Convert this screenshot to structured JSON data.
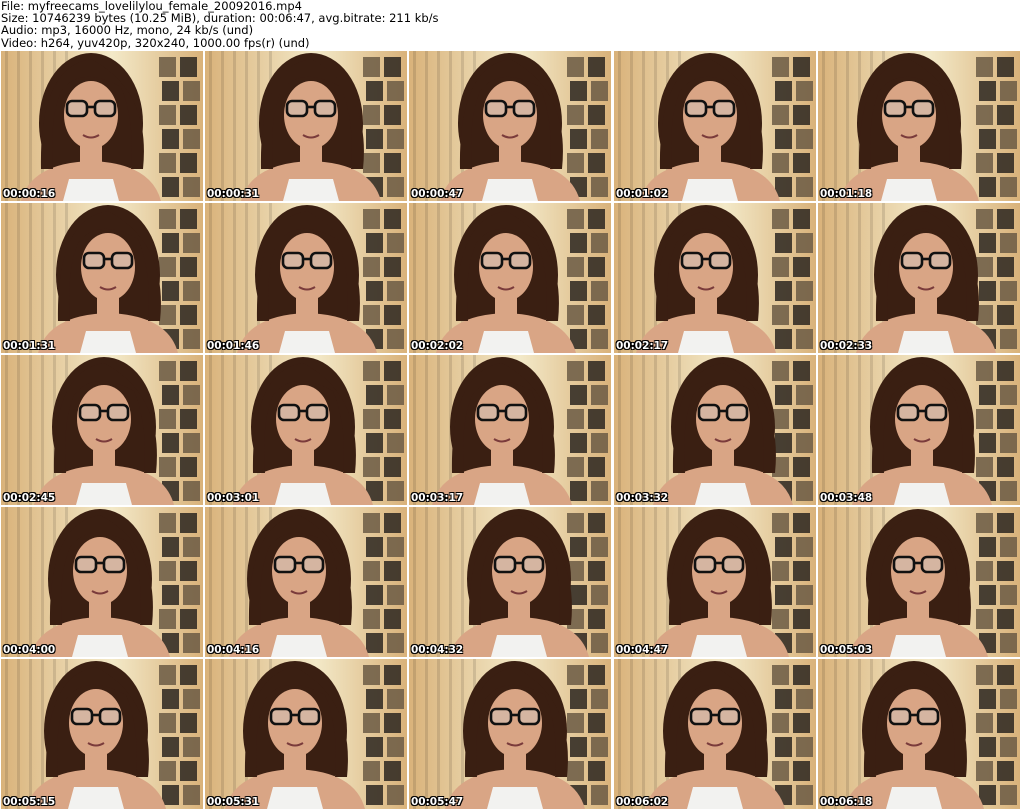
{
  "header": {
    "file": "File: myfreecams_lovelilylou_female_20092016.mp4",
    "size": "Size: 10746239 bytes (10.25 MiB), duration: 00:06:47, avg.bitrate: 211 kb/s",
    "audio": "Audio: mp3, 16000 Hz, mono, 24 kb/s (und)",
    "video": "Video: h264, yuv420p, 320x240, 1000.00 fps(r) (und)"
  },
  "colors": {
    "wall_light": "#f3e9c8",
    "wall_warm": "#d9b27a",
    "hair": "#3a1f12",
    "skin": "#d9a585",
    "posters": "#2b2620",
    "garment": "#f2f2f0",
    "shadow": "#1c1410"
  },
  "thumbnails": [
    {
      "timestamp": "00:00:16"
    },
    {
      "timestamp": "00:00:31"
    },
    {
      "timestamp": "00:00:47"
    },
    {
      "timestamp": "00:01:02"
    },
    {
      "timestamp": "00:01:18"
    },
    {
      "timestamp": "00:01:31"
    },
    {
      "timestamp": "00:01:46"
    },
    {
      "timestamp": "00:02:02"
    },
    {
      "timestamp": "00:02:17"
    },
    {
      "timestamp": "00:02:33"
    },
    {
      "timestamp": "00:02:45"
    },
    {
      "timestamp": "00:03:01"
    },
    {
      "timestamp": "00:03:17"
    },
    {
      "timestamp": "00:03:32"
    },
    {
      "timestamp": "00:03:48"
    },
    {
      "timestamp": "00:04:00"
    },
    {
      "timestamp": "00:04:16"
    },
    {
      "timestamp": "00:04:32"
    },
    {
      "timestamp": "00:04:47"
    },
    {
      "timestamp": "00:05:03"
    },
    {
      "timestamp": "00:05:15"
    },
    {
      "timestamp": "00:05:31"
    },
    {
      "timestamp": "00:05:47"
    },
    {
      "timestamp": "00:06:02"
    },
    {
      "timestamp": "00:06:18"
    }
  ]
}
